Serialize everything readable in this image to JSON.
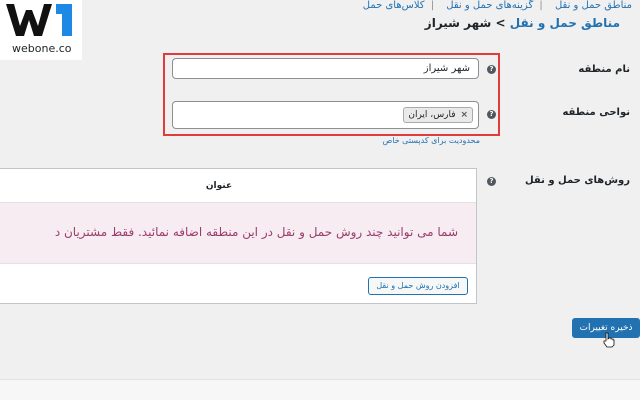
{
  "brand": {
    "logo_text": "webone.co"
  },
  "breadcrumb_links": {
    "zones": "مناطق حمل و نقل",
    "sep": "|",
    "options": "گزینه‌های حمل و نقل",
    "classes": "کلاس‌های حمل"
  },
  "heading": {
    "parent": "مناطق حمل و نقل",
    "separator": ">",
    "current": "شهر شیراز"
  },
  "zone_name": {
    "label": "نام منطقه",
    "value": "شهر شیراز"
  },
  "zone_regions": {
    "label": "نواحی منطقه",
    "token": "فارس، ایران",
    "remove": "×"
  },
  "postcode_link": "محدودیت برای کدپستی خاص",
  "shipping_methods": {
    "label": "روش‌های حمل و نقل",
    "column_title": "عنوان",
    "notice": "شما می توانید چند روش حمل و نقل در این منطقه اضافه نمائید. فقط مشتریان د",
    "add_button": "افزودن روش حمل و نقل"
  },
  "save_button": "ذخیره تغییرات",
  "help_glyph": "?",
  "colors": {
    "accent": "#2271b1",
    "highlight": "#e23b3b",
    "notice": "#9a3d6c"
  }
}
